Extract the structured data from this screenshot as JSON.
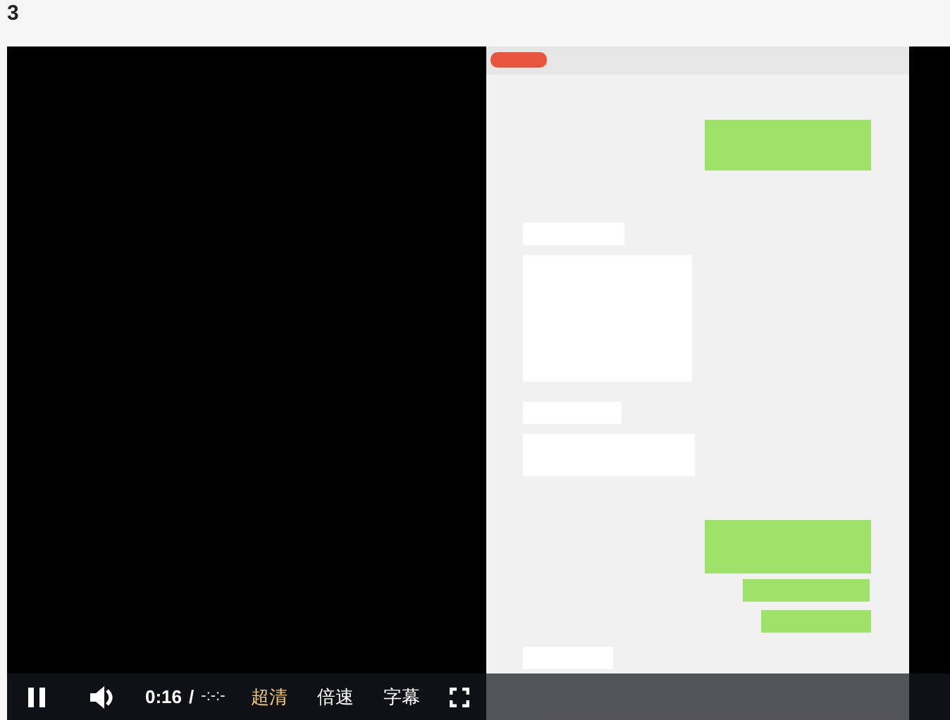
{
  "heading": "3",
  "player": {
    "playing": true,
    "muted": false,
    "elapsed": "0:16",
    "separator": "/",
    "duration": "-:-:-",
    "menu": [
      {
        "label": "超清",
        "selected": true
      },
      {
        "label": "倍速",
        "selected": false
      },
      {
        "label": "字幕",
        "selected": false
      }
    ]
  }
}
